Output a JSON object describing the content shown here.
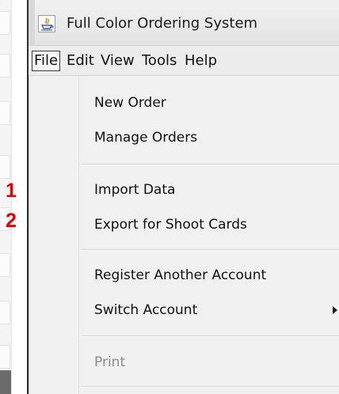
{
  "window": {
    "title": "Full Color Ordering System",
    "icon": "java-app-icon"
  },
  "menubar": {
    "items": [
      {
        "label": "File",
        "active": true
      },
      {
        "label": "Edit"
      },
      {
        "label": "View"
      },
      {
        "label": "Tools"
      },
      {
        "label": "Help"
      }
    ]
  },
  "file_menu": {
    "items": [
      {
        "label": "New Order",
        "enabled": true
      },
      {
        "label": "Manage Orders",
        "enabled": true
      },
      {
        "label": "Import Data",
        "enabled": true
      },
      {
        "label": "Export for Shoot Cards",
        "enabled": true
      },
      {
        "label": "Register Another Account",
        "enabled": true
      },
      {
        "label": "Switch Account",
        "enabled": true,
        "submenu": true
      },
      {
        "label": "Print",
        "enabled": false
      }
    ]
  },
  "annotations": [
    "1",
    "2"
  ],
  "colors": {
    "annotation": "#e30000",
    "disabled_text": "#8c8c8c",
    "menu_background": "#f0f0f0"
  }
}
